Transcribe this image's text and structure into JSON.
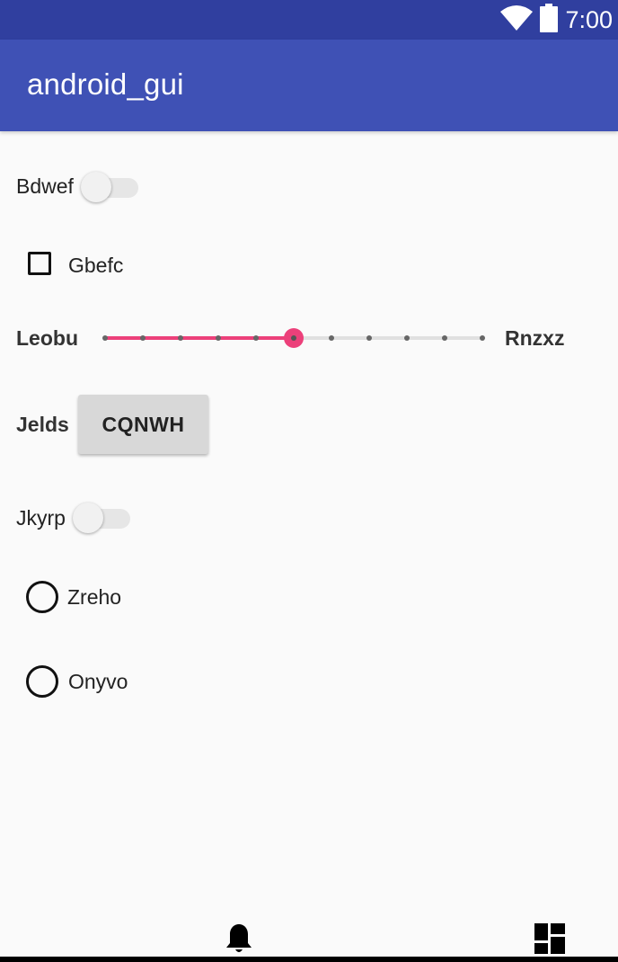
{
  "status_bar": {
    "time": "7:00",
    "icons": [
      "wifi-icon",
      "battery-icon"
    ]
  },
  "app_bar": {
    "title": "android_gui"
  },
  "controls": {
    "switch_1": {
      "label": "Bdwef",
      "checked": false
    },
    "checkbox_1": {
      "label": "Gbefc",
      "checked": false
    },
    "slider": {
      "start_label": "Leobu",
      "end_label": "Rnzxz",
      "min": 0,
      "max": 10,
      "value": 5
    },
    "button_row": {
      "label": "Jelds",
      "button_text": "CQNWH"
    },
    "switch_2": {
      "label": "Jkyrp",
      "checked": false
    },
    "radio_1": {
      "label": "Zreho",
      "checked": false
    },
    "radio_2": {
      "label": "Onyvo",
      "checked": false
    }
  },
  "bottom_nav": {
    "items": [
      "bell-icon",
      "dashboard-icon"
    ]
  },
  "colors": {
    "status_bar": "#303f9f",
    "app_bar": "#3f51b5",
    "accent": "#ec407a",
    "background": "#fafafa"
  }
}
